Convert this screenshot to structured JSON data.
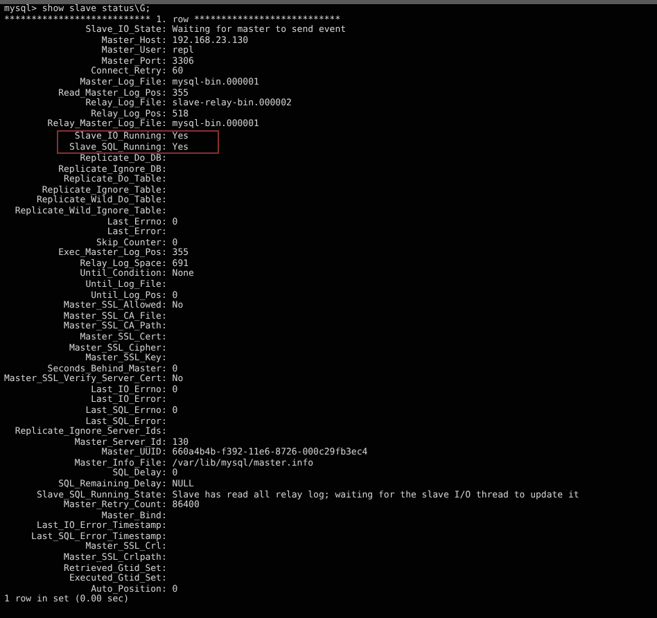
{
  "terminal": {
    "command_line": "mysql> show slave status\\G;",
    "row_header": "*************************** 1. row ***************************",
    "fields": [
      {
        "label": "Slave_IO_State:",
        "value": "Waiting for master to send event",
        "highlighted": false
      },
      {
        "label": "Master_Host:",
        "value": "192.168.23.130",
        "highlighted": false
      },
      {
        "label": "Master_User:",
        "value": "repl",
        "highlighted": false
      },
      {
        "label": "Master_Port:",
        "value": "3306",
        "highlighted": false
      },
      {
        "label": "Connect_Retry:",
        "value": "60",
        "highlighted": false
      },
      {
        "label": "Master_Log_File:",
        "value": "mysql-bin.000001",
        "highlighted": false
      },
      {
        "label": "Read_Master_Log_Pos:",
        "value": "355",
        "highlighted": false
      },
      {
        "label": "Relay_Log_File:",
        "value": "slave-relay-bin.000002",
        "highlighted": false
      },
      {
        "label": "Relay_Log_Pos:",
        "value": "518",
        "highlighted": false
      },
      {
        "label": "Relay_Master_Log_File:",
        "value": "mysql-bin.000001",
        "highlighted": false
      },
      {
        "label": "Slave_IO_Running:",
        "value": "Yes",
        "highlighted": true
      },
      {
        "label": "Slave_SQL_Running:",
        "value": "Yes",
        "highlighted": true
      },
      {
        "label": "Replicate_Do_DB:",
        "highlighted": false
      },
      {
        "label": "Replicate_Ignore_DB:",
        "highlighted": false
      },
      {
        "label": "Replicate_Do_Table:",
        "highlighted": false
      },
      {
        "label": "Replicate_Ignore_Table:",
        "highlighted": false
      },
      {
        "label": "Replicate_Wild_Do_Table:",
        "highlighted": false
      },
      {
        "label": "Replicate_Wild_Ignore_Table:",
        "highlighted": false
      },
      {
        "label": "Last_Errno:",
        "value": "0",
        "highlighted": false
      },
      {
        "label": "Last_Error:",
        "highlighted": false
      },
      {
        "label": "Skip_Counter:",
        "value": "0",
        "highlighted": false
      },
      {
        "label": "Exec_Master_Log_Pos:",
        "value": "355",
        "highlighted": false
      },
      {
        "label": "Relay_Log_Space:",
        "value": "691",
        "highlighted": false
      },
      {
        "label": "Until_Condition:",
        "value": "None",
        "highlighted": false
      },
      {
        "label": "Until_Log_File:",
        "highlighted": false
      },
      {
        "label": "Until_Log_Pos:",
        "value": "0",
        "highlighted": false
      },
      {
        "label": "Master_SSL_Allowed:",
        "value": "No",
        "highlighted": false
      },
      {
        "label": "Master_SSL_CA_File:",
        "highlighted": false
      },
      {
        "label": "Master_SSL_CA_Path:",
        "highlighted": false
      },
      {
        "label": "Master_SSL_Cert:",
        "highlighted": false
      },
      {
        "label": "Master_SSL_Cipher:",
        "highlighted": false
      },
      {
        "label": "Master_SSL_Key:",
        "highlighted": false
      },
      {
        "label": "Seconds_Behind_Master:",
        "value": "0",
        "highlighted": false
      },
      {
        "label": "Master_SSL_Verify_Server_Cert:",
        "value": "No",
        "highlighted": false
      },
      {
        "label": "Last_IO_Errno:",
        "value": "0",
        "highlighted": false
      },
      {
        "label": "Last_IO_Error:",
        "highlighted": false
      },
      {
        "label": "Last_SQL_Errno:",
        "value": "0",
        "highlighted": false
      },
      {
        "label": "Last_SQL_Error:",
        "highlighted": false
      },
      {
        "label": "Replicate_Ignore_Server_Ids:",
        "highlighted": false
      },
      {
        "label": "Master_Server_Id:",
        "value": "130",
        "highlighted": false
      },
      {
        "label": "Master_UUID:",
        "value": "660a4b4b-f392-11e6-8726-000c29fb3ec4",
        "highlighted": false
      },
      {
        "label": "Master_Info_File:",
        "value": "/var/lib/mysql/master.info",
        "highlighted": false
      },
      {
        "label": "SQL_Delay:",
        "value": "0",
        "highlighted": false
      },
      {
        "label": "SQL_Remaining_Delay:",
        "value": "NULL",
        "highlighted": false
      },
      {
        "label": "Slave_SQL_Running_State:",
        "value": "Slave has read all relay log; waiting for the slave I/O thread to update it",
        "highlighted": false
      },
      {
        "label": "Master_Retry_Count:",
        "value": "86400",
        "highlighted": false
      },
      {
        "label": "Master_Bind:",
        "highlighted": false
      },
      {
        "label": "Last_IO_Error_Timestamp:",
        "highlighted": false
      },
      {
        "label": "Last_SQL_Error_Timestamp:",
        "highlighted": false
      },
      {
        "label": "Master_SSL_Crl:",
        "highlighted": false
      },
      {
        "label": "Master_SSL_Crlpath:",
        "highlighted": false
      },
      {
        "label": "Retrieved_Gtid_Set:",
        "highlighted": false
      },
      {
        "label": "Executed_Gtid_Set:",
        "highlighted": false
      },
      {
        "label": "Auto_Position:",
        "value": "0",
        "highlighted": false
      }
    ],
    "result_line": "1 row in set (0.00 sec)"
  }
}
